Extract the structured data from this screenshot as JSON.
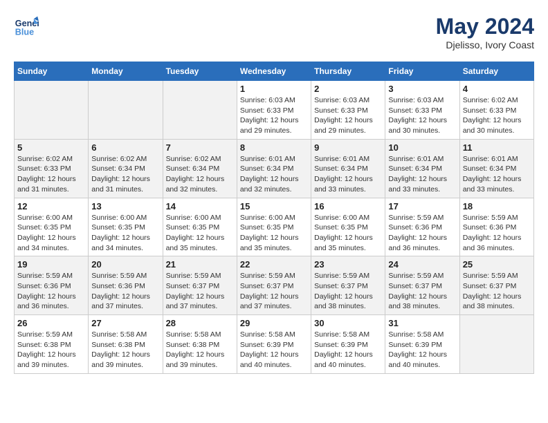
{
  "header": {
    "logo_line1": "General",
    "logo_line2": "Blue",
    "month_year": "May 2024",
    "location": "Djelisso, Ivory Coast"
  },
  "weekdays": [
    "Sunday",
    "Monday",
    "Tuesday",
    "Wednesday",
    "Thursday",
    "Friday",
    "Saturday"
  ],
  "weeks": [
    [
      {
        "day": "",
        "info": ""
      },
      {
        "day": "",
        "info": ""
      },
      {
        "day": "",
        "info": ""
      },
      {
        "day": "1",
        "info": "Sunrise: 6:03 AM\nSunset: 6:33 PM\nDaylight: 12 hours\nand 29 minutes."
      },
      {
        "day": "2",
        "info": "Sunrise: 6:03 AM\nSunset: 6:33 PM\nDaylight: 12 hours\nand 29 minutes."
      },
      {
        "day": "3",
        "info": "Sunrise: 6:03 AM\nSunset: 6:33 PM\nDaylight: 12 hours\nand 30 minutes."
      },
      {
        "day": "4",
        "info": "Sunrise: 6:02 AM\nSunset: 6:33 PM\nDaylight: 12 hours\nand 30 minutes."
      }
    ],
    [
      {
        "day": "5",
        "info": "Sunrise: 6:02 AM\nSunset: 6:33 PM\nDaylight: 12 hours\nand 31 minutes."
      },
      {
        "day": "6",
        "info": "Sunrise: 6:02 AM\nSunset: 6:34 PM\nDaylight: 12 hours\nand 31 minutes."
      },
      {
        "day": "7",
        "info": "Sunrise: 6:02 AM\nSunset: 6:34 PM\nDaylight: 12 hours\nand 32 minutes."
      },
      {
        "day": "8",
        "info": "Sunrise: 6:01 AM\nSunset: 6:34 PM\nDaylight: 12 hours\nand 32 minutes."
      },
      {
        "day": "9",
        "info": "Sunrise: 6:01 AM\nSunset: 6:34 PM\nDaylight: 12 hours\nand 33 minutes."
      },
      {
        "day": "10",
        "info": "Sunrise: 6:01 AM\nSunset: 6:34 PM\nDaylight: 12 hours\nand 33 minutes."
      },
      {
        "day": "11",
        "info": "Sunrise: 6:01 AM\nSunset: 6:34 PM\nDaylight: 12 hours\nand 33 minutes."
      }
    ],
    [
      {
        "day": "12",
        "info": "Sunrise: 6:00 AM\nSunset: 6:35 PM\nDaylight: 12 hours\nand 34 minutes."
      },
      {
        "day": "13",
        "info": "Sunrise: 6:00 AM\nSunset: 6:35 PM\nDaylight: 12 hours\nand 34 minutes."
      },
      {
        "day": "14",
        "info": "Sunrise: 6:00 AM\nSunset: 6:35 PM\nDaylight: 12 hours\nand 35 minutes."
      },
      {
        "day": "15",
        "info": "Sunrise: 6:00 AM\nSunset: 6:35 PM\nDaylight: 12 hours\nand 35 minutes."
      },
      {
        "day": "16",
        "info": "Sunrise: 6:00 AM\nSunset: 6:35 PM\nDaylight: 12 hours\nand 35 minutes."
      },
      {
        "day": "17",
        "info": "Sunrise: 5:59 AM\nSunset: 6:36 PM\nDaylight: 12 hours\nand 36 minutes."
      },
      {
        "day": "18",
        "info": "Sunrise: 5:59 AM\nSunset: 6:36 PM\nDaylight: 12 hours\nand 36 minutes."
      }
    ],
    [
      {
        "day": "19",
        "info": "Sunrise: 5:59 AM\nSunset: 6:36 PM\nDaylight: 12 hours\nand 36 minutes."
      },
      {
        "day": "20",
        "info": "Sunrise: 5:59 AM\nSunset: 6:36 PM\nDaylight: 12 hours\nand 37 minutes."
      },
      {
        "day": "21",
        "info": "Sunrise: 5:59 AM\nSunset: 6:37 PM\nDaylight: 12 hours\nand 37 minutes."
      },
      {
        "day": "22",
        "info": "Sunrise: 5:59 AM\nSunset: 6:37 PM\nDaylight: 12 hours\nand 37 minutes."
      },
      {
        "day": "23",
        "info": "Sunrise: 5:59 AM\nSunset: 6:37 PM\nDaylight: 12 hours\nand 38 minutes."
      },
      {
        "day": "24",
        "info": "Sunrise: 5:59 AM\nSunset: 6:37 PM\nDaylight: 12 hours\nand 38 minutes."
      },
      {
        "day": "25",
        "info": "Sunrise: 5:59 AM\nSunset: 6:37 PM\nDaylight: 12 hours\nand 38 minutes."
      }
    ],
    [
      {
        "day": "26",
        "info": "Sunrise: 5:59 AM\nSunset: 6:38 PM\nDaylight: 12 hours\nand 39 minutes."
      },
      {
        "day": "27",
        "info": "Sunrise: 5:58 AM\nSunset: 6:38 PM\nDaylight: 12 hours\nand 39 minutes."
      },
      {
        "day": "28",
        "info": "Sunrise: 5:58 AM\nSunset: 6:38 PM\nDaylight: 12 hours\nand 39 minutes."
      },
      {
        "day": "29",
        "info": "Sunrise: 5:58 AM\nSunset: 6:39 PM\nDaylight: 12 hours\nand 40 minutes."
      },
      {
        "day": "30",
        "info": "Sunrise: 5:58 AM\nSunset: 6:39 PM\nDaylight: 12 hours\nand 40 minutes."
      },
      {
        "day": "31",
        "info": "Sunrise: 5:58 AM\nSunset: 6:39 PM\nDaylight: 12 hours\nand 40 minutes."
      },
      {
        "day": "",
        "info": ""
      }
    ]
  ]
}
